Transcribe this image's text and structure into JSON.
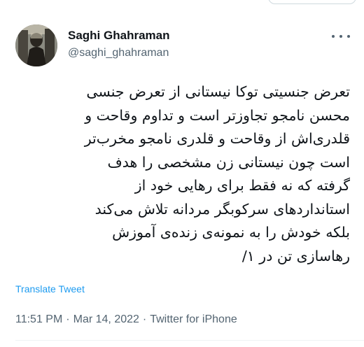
{
  "author": {
    "name": "Saghi Ghahraman",
    "handle": "@saghi_ghahraman"
  },
  "tweet": {
    "lines": [
      "تعرض جنسیتی توکا نیستانی از تعرض جنسی",
      "محسن نامجو تجاوزتر است و تداوم وقاحت و",
      "قلدری‌اش از وقاحت و قلدری نامجو مخرب‌تر",
      "است چون نیستانی زن مشخصی را هدف",
      "گرفته که نه فقط برای رهایی خود از",
      "استانداردهای سرکوبگر مردانه تلاش می‌کند",
      "بلکه خودش را به نمونه‌ی زنده‌ی آموزش",
      "رهاسازی تن در ۱/"
    ]
  },
  "actions": {
    "translate_label": "Translate Tweet"
  },
  "meta": {
    "time": "11:51 PM",
    "date": "Mar 14, 2022",
    "source": "Twitter for iPhone",
    "separator": "·"
  },
  "icons": {
    "more": "more-horizontal-icon"
  },
  "colors": {
    "link": "#1d9bf0",
    "secondary_text": "#536471",
    "primary_text": "#0f1419"
  }
}
